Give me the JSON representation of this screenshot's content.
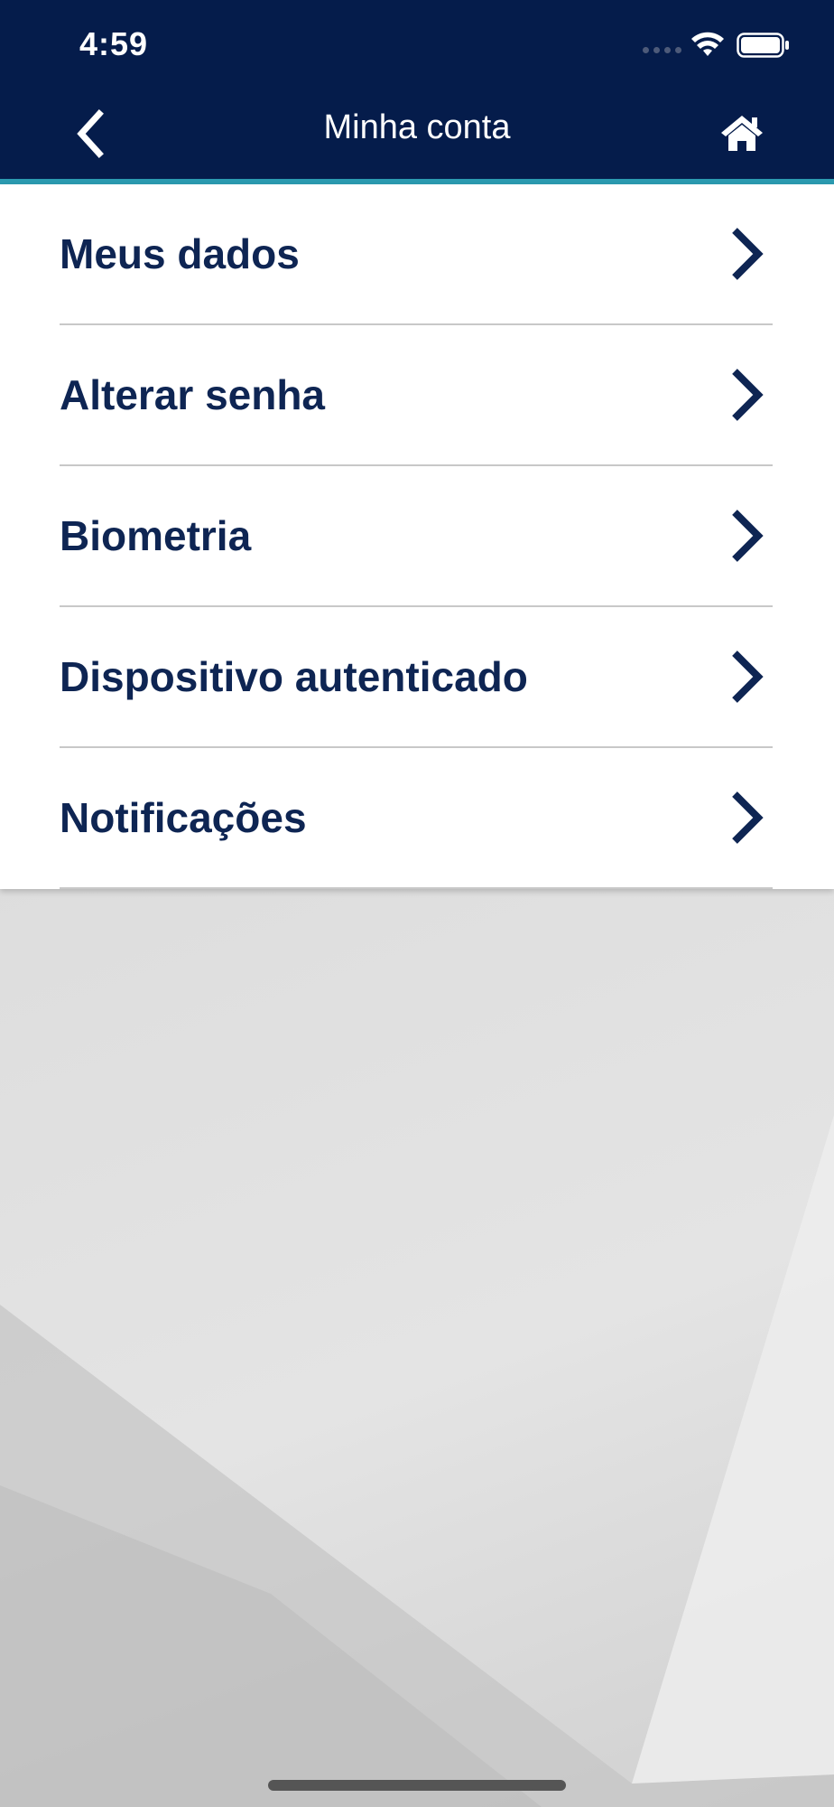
{
  "status_bar": {
    "time": "4:59",
    "wifi_icon": "wifi-icon",
    "battery_icon": "battery-icon"
  },
  "header": {
    "title": "Minha conta",
    "back_icon": "chevron-left-icon",
    "home_icon": "home-icon",
    "background_color": "#051c4b",
    "accent_color": "#2b9ab0"
  },
  "menu": {
    "items": [
      {
        "label": "Meus dados",
        "icon": "chevron-right-icon"
      },
      {
        "label": "Alterar senha",
        "icon": "chevron-right-icon"
      },
      {
        "label": "Biometria",
        "icon": "chevron-right-icon"
      },
      {
        "label": "Dispositivo autenticado",
        "icon": "chevron-right-icon"
      },
      {
        "label": "Notificações",
        "icon": "chevron-right-icon"
      }
    ],
    "text_color": "#0e2553"
  }
}
